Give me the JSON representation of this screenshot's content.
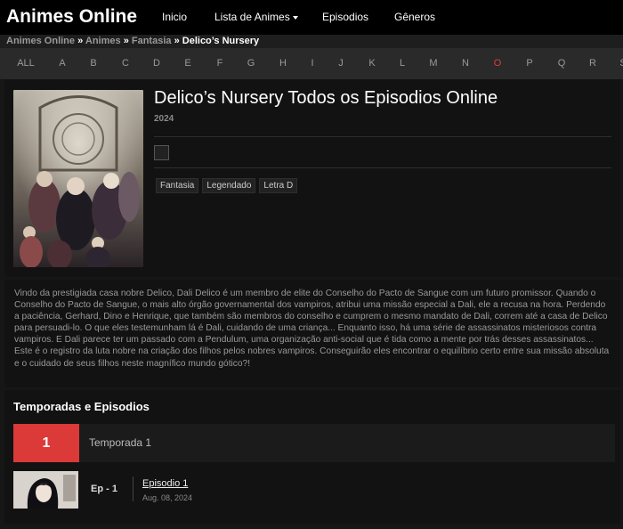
{
  "nav": {
    "brand": "Animes Online",
    "items": [
      {
        "label": "Inicio"
      },
      {
        "label": "Lista de Animes"
      },
      {
        "label": "Episodios"
      },
      {
        "label": "Gêneros"
      }
    ]
  },
  "breadcrumb": {
    "items": [
      "Animes Online",
      "Animes",
      "Fantasia"
    ],
    "current": "Delico’s Nursery",
    "separator": "»"
  },
  "letters": {
    "items": [
      "ALL",
      "A",
      "B",
      "C",
      "D",
      "E",
      "F",
      "G",
      "H",
      "I",
      "J",
      "K",
      "L",
      "M",
      "N",
      "O",
      "P",
      "Q",
      "R",
      "S"
    ],
    "active": "O"
  },
  "anime": {
    "title": "Delico’s Nursery Todos os Episodios Online",
    "year": "2024",
    "tags": [
      "Fantasia",
      "Legendado",
      "Letra D"
    ],
    "synopsis": "Vindo da prestigiada casa nobre Delico, Dali Delico é um membro de elite do Conselho do Pacto de Sangue com um futuro promissor. Quando o Conselho do Pacto de Sangue, o mais alto órgão governamental dos vampiros, atribui uma missão especial a Dali, ele a recusa na hora. Perdendo a paciência, Gerhard, Dino e Henrique, que também são membros do conselho e cumprem o mesmo mandato de Dali, correm até a casa de Delico para persuadi-lo. O que eles testemunham lá é Dali, cuidando de uma criança... Enquanto isso, há uma série de assassinatos misteriosos contra vampiros. E Dali parece ter um passado com a Pendulum, uma organização anti-social que é tida como a mente por trás desses assassinatos... Este é o registro da luta nobre na criação dos filhos pelos nobres vampiros. Conseguirão eles encontrar o equilíbrio certo entre sua missão absoluta e o cuidado de seus filhos neste magnífico mundo gótico?!"
  },
  "seasons": {
    "heading": "Temporadas e Episodios",
    "season_number": "1",
    "season_label": "Temporada 1",
    "episodes": [
      {
        "num": "Ep - 1",
        "title": "Episodio 1",
        "date": "Aug. 08, 2024"
      }
    ]
  },
  "colors": {
    "accent": "#dc3939",
    "background": "#161616",
    "panel": "#121212",
    "navbar": "#000000"
  }
}
